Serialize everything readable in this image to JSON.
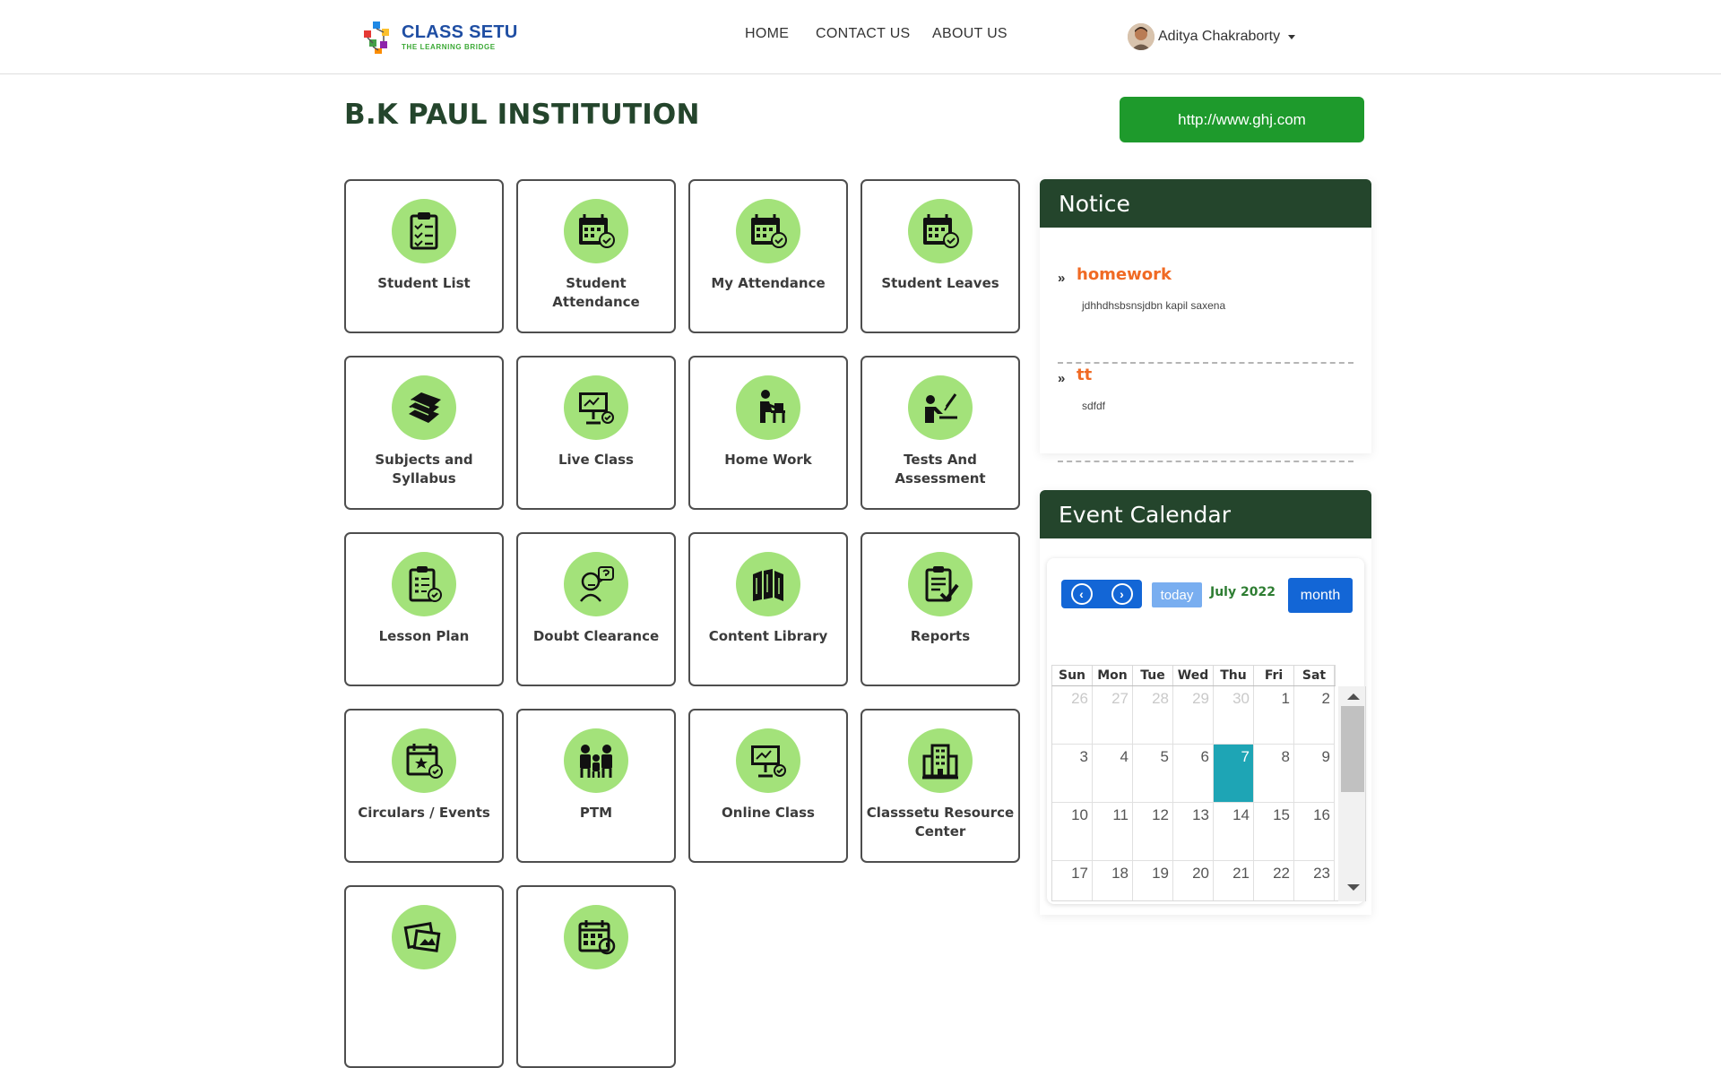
{
  "header": {
    "logo": {
      "title": "CLASS SETU",
      "subtitle": "THE LEARNING BRIDGE"
    },
    "nav": [
      "HOME",
      "CONTACT US",
      "ABOUT US"
    ],
    "user_name": "Aditya Chakraborty"
  },
  "institution": {
    "name": "B.K PAUL INSTITUTION",
    "website": "http://www.ghj.com"
  },
  "tiles": [
    {
      "label": "Student List",
      "icon": "clipboard-list-icon"
    },
    {
      "label": "Student Attendance",
      "icon": "calendar-check-icon"
    },
    {
      "label": "My Attendance",
      "icon": "calendar-check-icon"
    },
    {
      "label": "Student Leaves",
      "icon": "calendar-check-icon"
    },
    {
      "label": "Subjects and Syllabus",
      "icon": "books-icon"
    },
    {
      "label": "Live Class",
      "icon": "presentation-screen-icon"
    },
    {
      "label": "Home Work",
      "icon": "person-at-desk-icon"
    },
    {
      "label": "Tests And Assessment",
      "icon": "person-writing-icon"
    },
    {
      "label": "Lesson Plan",
      "icon": "clipboard-check-icon"
    },
    {
      "label": "Doubt Clearance",
      "icon": "thinking-person-icon"
    },
    {
      "label": "Content Library",
      "icon": "book-stack-icon"
    },
    {
      "label": "Reports",
      "icon": "report-check-icon"
    },
    {
      "label": "Circulars / Events",
      "icon": "calendar-star-icon"
    },
    {
      "label": "PTM",
      "icon": "family-icon"
    },
    {
      "label": "Online Class",
      "icon": "presentation-screen-icon"
    },
    {
      "label": "Classsetu Resource Center",
      "icon": "building-icon"
    },
    {
      "label": "",
      "icon": "gallery-icon"
    },
    {
      "label": "",
      "icon": "calendar-grid-icon"
    }
  ],
  "notice": {
    "title": "Notice",
    "items": [
      {
        "title": "homework",
        "description": "jdhhdhsbsnsjdbn kapil saxena"
      },
      {
        "title": "tt",
        "description": "sdfdf"
      }
    ]
  },
  "calendar": {
    "title": "Event Calendar",
    "today_label": "today",
    "month_label": "July 2022",
    "view_label": "month",
    "prev_icon": "chevron-left-icon",
    "next_icon": "chevron-right-icon",
    "days_of_week": [
      "Sun",
      "Mon",
      "Tue",
      "Wed",
      "Thu",
      "Fri",
      "Sat"
    ],
    "weeks": [
      [
        "26",
        "27",
        "28",
        "29",
        "30",
        "1",
        "2"
      ],
      [
        "3",
        "4",
        "5",
        "6",
        "7",
        "8",
        "9"
      ],
      [
        "10",
        "11",
        "12",
        "13",
        "14",
        "15",
        "16"
      ],
      [
        "17",
        "18",
        "19",
        "20",
        "21",
        "22",
        "23"
      ]
    ],
    "other_month_days": [
      "26",
      "27",
      "28",
      "29",
      "30"
    ],
    "today": "7"
  },
  "colors": {
    "brand_green": "#24452c",
    "button_green": "#1e9a2c",
    "icon_circle": "#a3e27a",
    "notice_title": "#f06a24",
    "calendar_blue": "#1366d6",
    "today_cell": "#1ea5b5"
  }
}
